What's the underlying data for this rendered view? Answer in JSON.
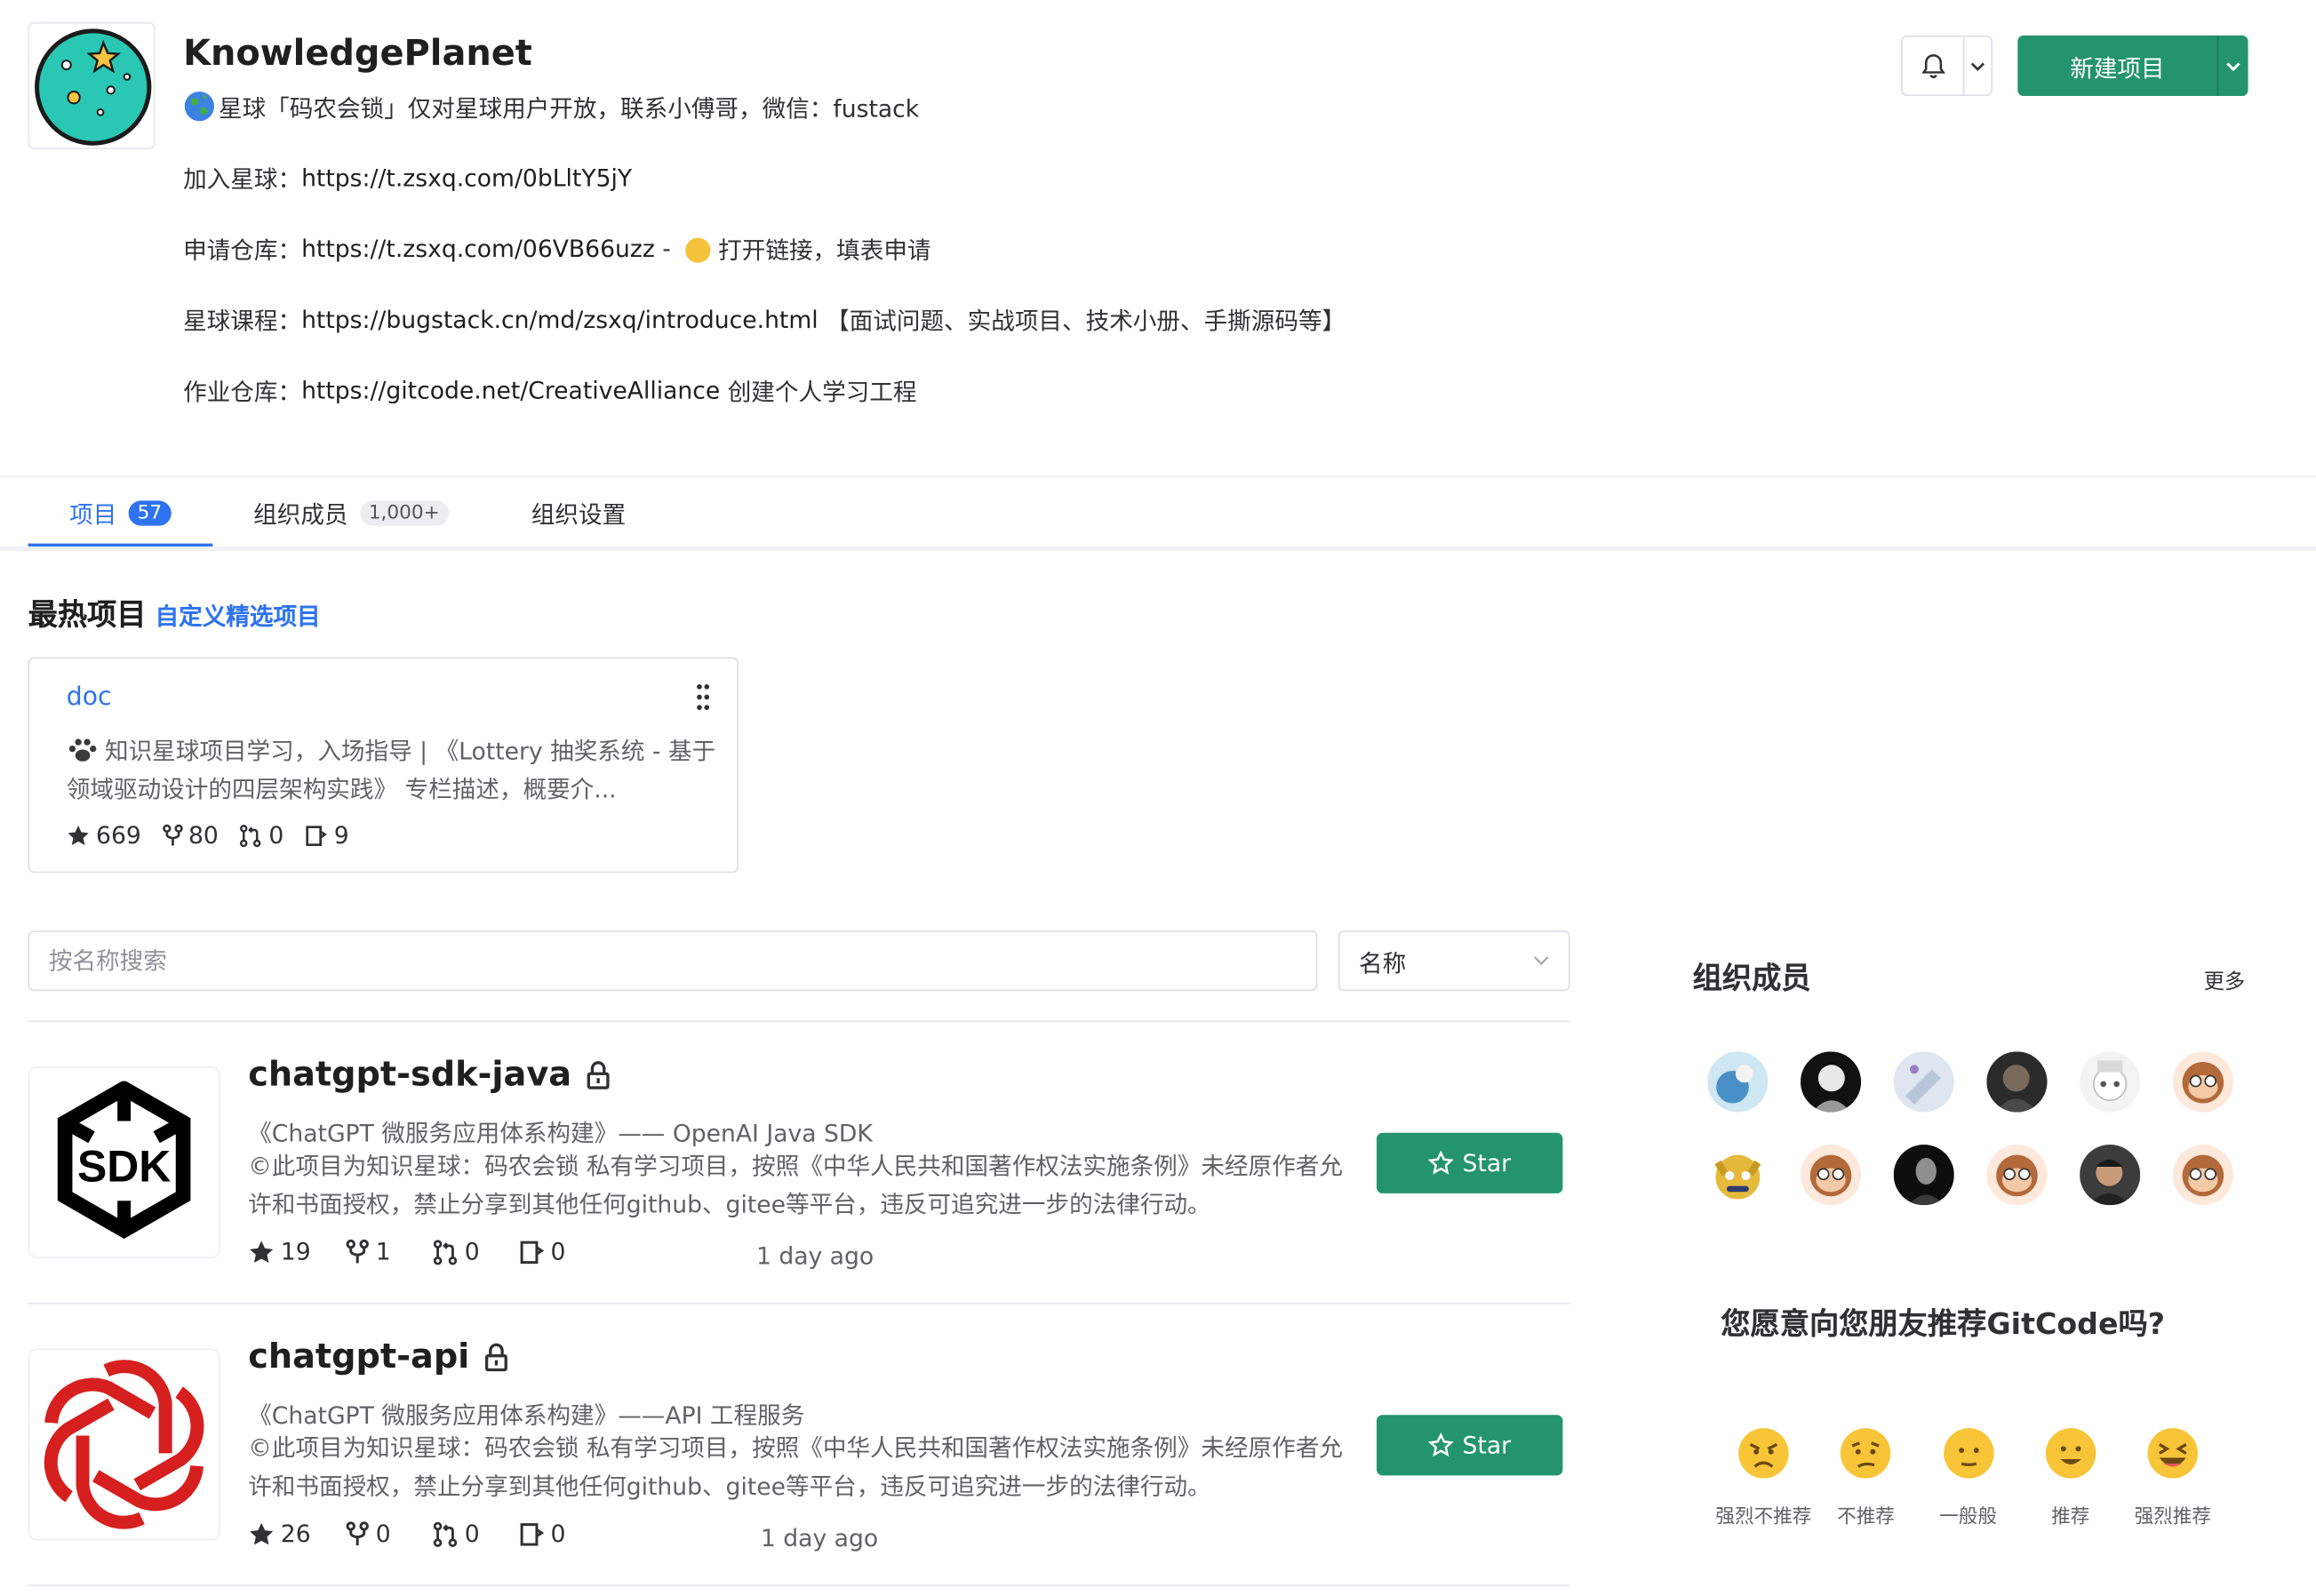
{
  "org": {
    "name": "KnowledgePlanet",
    "description": "星球「码农会锁」仅对星球用户开放，联系小傅哥，微信：fustack",
    "lines": [
      {
        "label": "加入星球：",
        "url": "https://t.zsxq.com/0bLltY5jY",
        "suffix": ""
      },
      {
        "label": "申请仓库：",
        "url": "https://t.zsxq.com/06VB66uzz",
        "suffix_before_emoji": " - ",
        "suffix": "打开链接，填表申请"
      },
      {
        "label": "星球课程：",
        "url": "https://bugstack.cn/md/zsxq/introduce.html",
        "suffix": " 【面试问题、实战项目、技术小册、手撕源码等】"
      },
      {
        "label": "作业仓库：",
        "url": "https://gitcode.net/CreativeAlliance",
        "suffix": " 创建个人学习工程"
      }
    ]
  },
  "header_actions": {
    "new_project_label": "新建项目"
  },
  "tabs": [
    {
      "label": "项目",
      "badge": "57",
      "active": true
    },
    {
      "label": "组织成员",
      "badge": "1,000+",
      "active": false
    },
    {
      "label": "组织设置",
      "badge": "",
      "active": false
    }
  ],
  "hot": {
    "title": "最热项目",
    "custom_link": "自定义精选项目",
    "card": {
      "name": "doc",
      "description": "知识星球项目学习，入场指导 | 《Lottery 抽奖系统 - 基于领域驱动设计的四层架构实践》 专栏描述，概要介...",
      "stars": "669",
      "forks": "80",
      "merge_requests": "0",
      "issues": "9"
    }
  },
  "search": {
    "placeholder": "按名称搜索",
    "sort_value": "名称"
  },
  "projects": [
    {
      "name": "chatgpt-sdk-java",
      "subtitle": "《ChatGPT 微服务应用体系构建》—— OpenAI Java SDK",
      "description": "©此项目为知识星球：码农会锁 私有学习项目，按照《中华人民共和国著作权法实施条例》未经原作者允许和书面授权，禁止分享到其他任何github、gitee等平台，违反可追究进一步的法律行动。",
      "stars": "19",
      "forks": "1",
      "merge_requests": "0",
      "issues": "0",
      "updated": "1 day ago",
      "star_label": "Star",
      "logo_text": "SDK"
    },
    {
      "name": "chatgpt-api",
      "subtitle": "《ChatGPT 微服务应用体系构建》——API 工程服务",
      "description": "©此项目为知识星球：码农会锁 私有学习项目，按照《中华人民共和国著作权法实施条例》未经原作者允许和书面授权，禁止分享到其他任何github、gitee等平台，违反可追究进一步的法律行动。",
      "stars": "26",
      "forks": "0",
      "merge_requests": "0",
      "issues": "0",
      "updated": "1 day ago",
      "star_label": "Star"
    }
  ],
  "sidebar": {
    "members_title": "组织成员",
    "more_label": "更多",
    "survey_question": "您愿意向您朋友推荐GitCode吗?",
    "survey_options": [
      "强烈不推荐",
      "不推荐",
      "一般般",
      "推荐",
      "强烈推荐"
    ]
  },
  "colors": {
    "primary_green": "#24946e",
    "link_blue": "#2e73f0"
  }
}
